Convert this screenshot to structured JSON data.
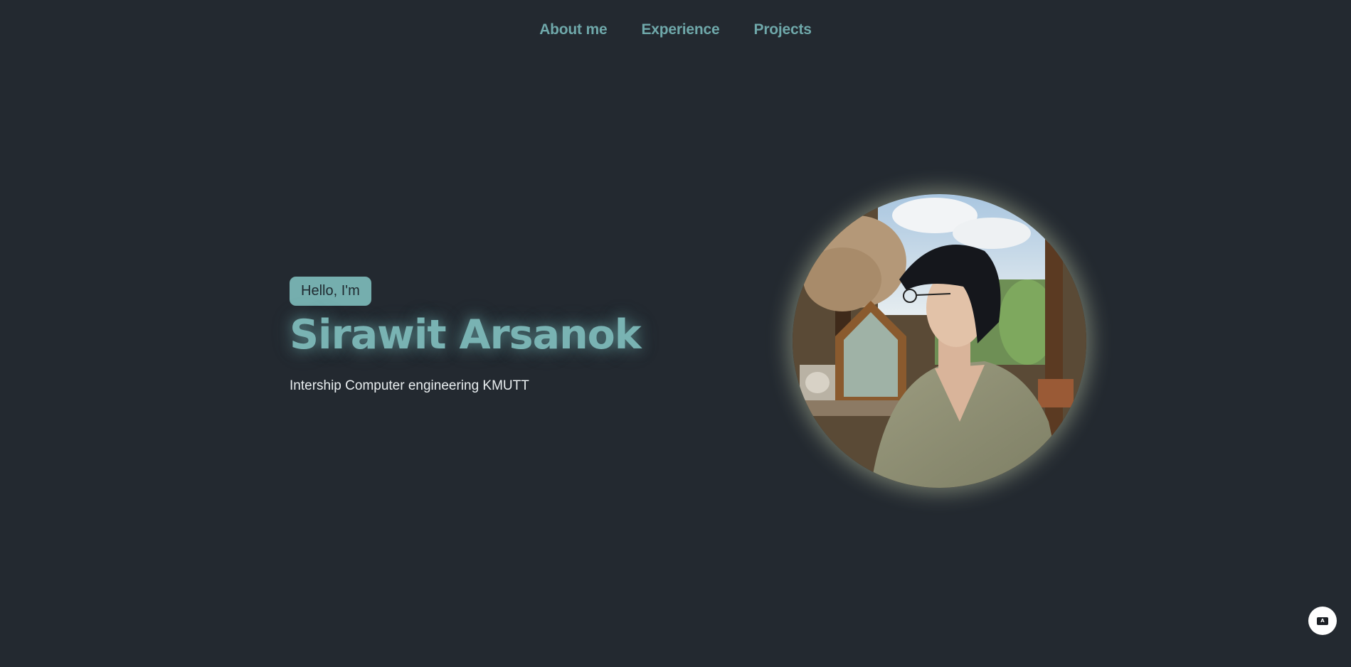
{
  "nav": {
    "items": [
      {
        "label": "About me"
      },
      {
        "label": "Experience"
      },
      {
        "label": "Projects"
      }
    ]
  },
  "hero": {
    "greeting": "Hello, I'm",
    "name": "Sirawit Arsanok",
    "subtitle": "Intership Computer engineering KMUTT",
    "photo_alt": "Sirawit Arsanok"
  },
  "floating_button": {
    "icon": "translate-icon",
    "glyph": "A"
  },
  "colors": {
    "background": "#232930",
    "accent": "#75aeae",
    "text": "#e9eef0"
  }
}
